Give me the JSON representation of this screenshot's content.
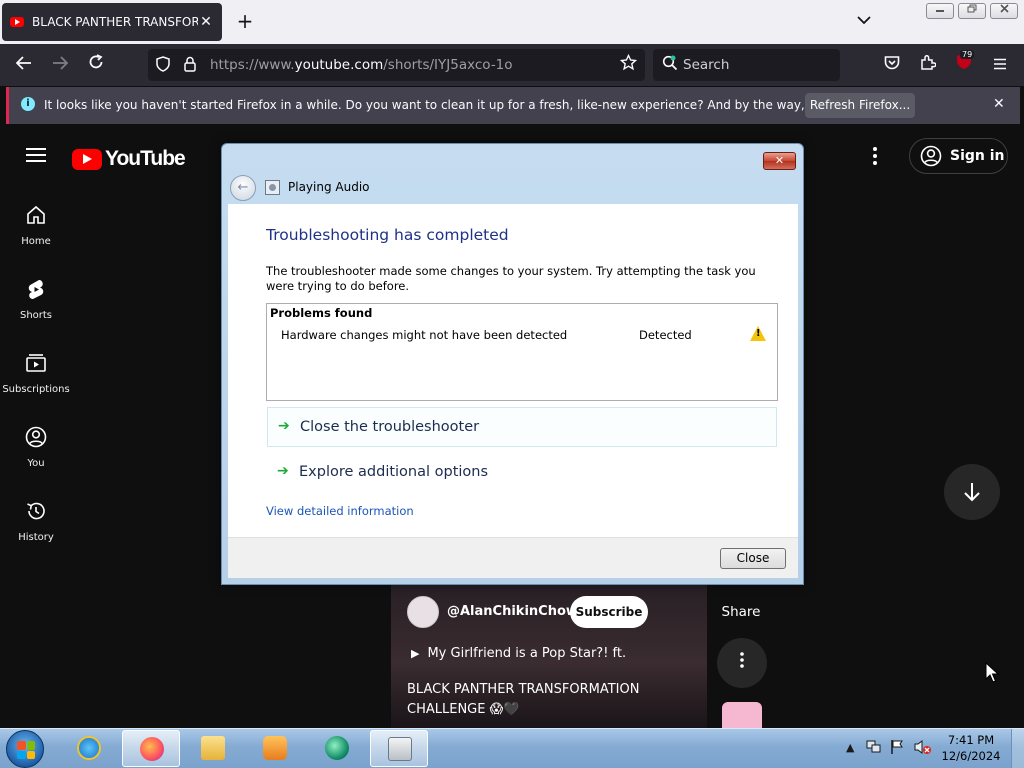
{
  "browser": {
    "tab_title": "BLACK PANTHER TRANSFORM",
    "tab_close": "✕",
    "new_tab": "+",
    "tab_list": "⌄",
    "window_min": "▭",
    "window_restore": "⧉",
    "window_close": "✕",
    "url_prefix": "https://www.",
    "url_domain": "youtube.com",
    "url_path": "/shorts/IYJ5axco-1o",
    "search_placeholder": "Search",
    "extension_badge": "79"
  },
  "notification": {
    "message": "It looks like you haven't started Firefox in a while. Do you want to clean it up for a fresh, like-new experience? And by the way, welcome back!",
    "button": "Refresh Firefox...",
    "close": "✕"
  },
  "youtube": {
    "logo": "YouTube",
    "sign_in": "Sign in",
    "nav": [
      {
        "label": "Home",
        "icon": "home-icon"
      },
      {
        "label": "Shorts",
        "icon": "shorts-icon"
      },
      {
        "label": "Subscriptions",
        "icon": "subscriptions-icon"
      },
      {
        "label": "You",
        "icon": "you-icon"
      },
      {
        "label": "History",
        "icon": "history-icon"
      }
    ],
    "short": {
      "channel": "@AlanChikinChow",
      "subscribe": "Subscribe",
      "song": "My Girlfriend is a Pop Star?! ft.",
      "caption": "BLACK PANTHER TRANSFORMATION CHALLENGE 😱🖤"
    },
    "share_label": "Share"
  },
  "dialog": {
    "window_title": "Playing Audio",
    "close_x": "✕",
    "heading": "Troubleshooting has completed",
    "description": "The troubleshooter made some changes to your system. Try attempting the task you were trying to do before.",
    "problems_header": "Problems found",
    "problems": [
      {
        "name": "Hardware changes might not have been detected",
        "status": "Detected",
        "icon": "warning-icon"
      }
    ],
    "options": [
      {
        "label": "Close the troubleshooter",
        "highlighted": true
      },
      {
        "label": "Explore additional options",
        "highlighted": false
      }
    ],
    "detail_link": "View detailed information",
    "close_button": "Close"
  },
  "taskbar": {
    "apps": [
      "internet-explorer-icon",
      "firefox-icon",
      "file-explorer-icon",
      "media-player-icon",
      "app-icon",
      "troubleshooter-icon"
    ],
    "time": "7:41 PM",
    "date": "12/6/2024"
  },
  "colors": {
    "firefox_dark": "#2b2a33",
    "youtube_red": "#ff0000",
    "dialog_heading": "#1e3287",
    "link": "#1a56b6"
  }
}
